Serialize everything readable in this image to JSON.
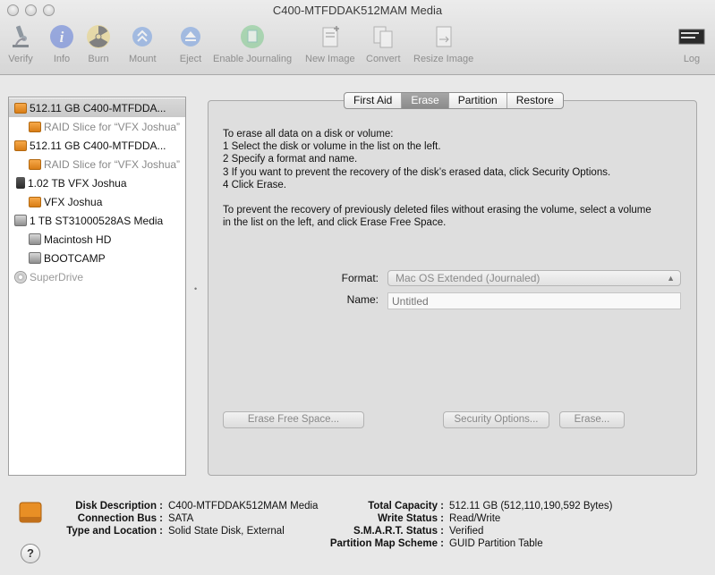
{
  "window": {
    "title": "C400-MTFDDAK512MAM Media"
  },
  "toolbar": {
    "verify": "Verify",
    "info": "Info",
    "burn": "Burn",
    "mount": "Mount",
    "eject": "Eject",
    "enable_journaling": "Enable Journaling",
    "new_image": "New Image",
    "convert": "Convert",
    "resize_image": "Resize Image",
    "log": "Log",
    "log_icon_text": "WARNIN\nY 7:36 F"
  },
  "sidebar": {
    "items": [
      {
        "label": "512.11 GB C400-MTFDDA...",
        "icon": "orange-disk-icon"
      },
      {
        "label": "RAID Slice for “VFX Joshua”",
        "icon": "orange-disk-icon"
      },
      {
        "label": "512.11 GB C400-MTFDDA...",
        "icon": "orange-disk-icon"
      },
      {
        "label": "RAID Slice for “VFX Joshua”",
        "icon": "orange-disk-icon"
      },
      {
        "label": "1.02 TB VFX Joshua",
        "icon": "raid-icon"
      },
      {
        "label": "VFX Joshua",
        "icon": "orange-disk-icon"
      },
      {
        "label": "1 TB ST31000528AS Media",
        "icon": "internal-disk-icon"
      },
      {
        "label": "Macintosh HD",
        "icon": "internal-disk-icon"
      },
      {
        "label": "BOOTCAMP",
        "icon": "internal-disk-icon"
      },
      {
        "label": "SuperDrive",
        "icon": "optical-drive-icon"
      }
    ]
  },
  "tabs": [
    "First Aid",
    "Erase",
    "Partition",
    "Restore"
  ],
  "erase": {
    "instructions": [
      "To erase all data on a disk or volume:",
      "1 Select the disk or volume in the list on the left.",
      "2 Specify a format and name.",
      "3 If you want to prevent the recovery of the disk’s erased data, click Security Options.",
      "4 Click Erase."
    ],
    "free_space_text": [
      "To prevent the recovery of previously deleted files without erasing the volume, select a volume",
      "in the list on the left, and click Erase Free Space."
    ],
    "format_label": "Format:",
    "format_value": "Mac OS Extended (Journaled)",
    "name_label": "Name:",
    "name_placeholder": "Untitled",
    "erase_free_space_button": "Erase Free Space...",
    "security_options_button": "Security Options...",
    "erase_button": "Erase..."
  },
  "details": {
    "left": [
      {
        "key": "Disk Description :",
        "value": "C400-MTFDDAK512MAM Media"
      },
      {
        "key": "Connection Bus :",
        "value": "SATA"
      },
      {
        "key": "Type and Location :",
        "value": "Solid State Disk, External"
      }
    ],
    "right": [
      {
        "key": "Total Capacity :",
        "value": "512.11 GB (512,110,190,592 Bytes)"
      },
      {
        "key": "Write Status :",
        "value": "Read/Write"
      },
      {
        "key": "S.M.A.R.T. Status :",
        "value": "Verified"
      },
      {
        "key": "Partition Map Scheme :",
        "value": "GUID Partition Table"
      }
    ],
    "help_label": "?"
  }
}
